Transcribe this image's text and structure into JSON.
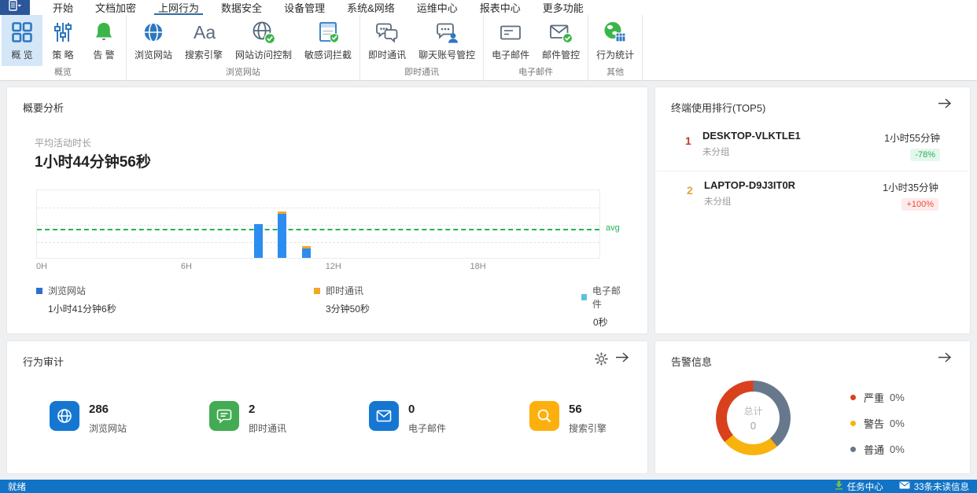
{
  "menubar": {
    "tabs": [
      {
        "name": "start",
        "label": "开始",
        "active": false
      },
      {
        "name": "doc-encrypt",
        "label": "文档加密",
        "active": false
      },
      {
        "name": "internet-behavior",
        "label": "上网行为",
        "active": true
      },
      {
        "name": "data-security",
        "label": "数据安全",
        "active": false
      },
      {
        "name": "device-mgmt",
        "label": "设备管理",
        "active": false
      },
      {
        "name": "system-network",
        "label": "系统&网络",
        "active": false
      },
      {
        "name": "ops-center",
        "label": "运维中心",
        "active": false
      },
      {
        "name": "report-center",
        "label": "报表中心",
        "active": false
      },
      {
        "name": "more-features",
        "label": "更多功能",
        "active": false
      }
    ]
  },
  "ribbon": {
    "groups": [
      {
        "label": "概览",
        "buttons": [
          {
            "name": "overview",
            "label": "概 览",
            "icon": "overview-grid-icon",
            "selected": true
          },
          {
            "name": "policy",
            "label": "策 略",
            "icon": "policy-sliders-icon",
            "selected": false
          },
          {
            "name": "alarm",
            "label": "告 警",
            "icon": "alarm-bell-icon",
            "selected": false
          }
        ]
      },
      {
        "label": "浏览网站",
        "buttons": [
          {
            "name": "browse-web",
            "label": "浏览网站",
            "icon": "browse-globe-icon",
            "selected": false
          },
          {
            "name": "search-engine",
            "label": "搜索引擎",
            "icon": "search-engine-icon",
            "selected": false
          },
          {
            "name": "site-access-control",
            "label": "网站访问控制",
            "icon": "site-access-icon",
            "selected": false
          },
          {
            "name": "sensitive-word-block",
            "label": "敏感词拦截",
            "icon": "sensitive-word-icon",
            "selected": false
          }
        ]
      },
      {
        "label": "即时通讯",
        "buttons": [
          {
            "name": "im",
            "label": "即时通讯",
            "icon": "im-chat-icon",
            "selected": false
          },
          {
            "name": "chat-account-control",
            "label": "聊天账号管控",
            "icon": "chat-account-icon",
            "selected": false
          }
        ]
      },
      {
        "label": "电子邮件",
        "buttons": [
          {
            "name": "email",
            "label": "电子邮件",
            "icon": "email-icon",
            "selected": false
          },
          {
            "name": "mail-control",
            "label": "邮件管控",
            "icon": "mail-control-icon",
            "selected": false
          }
        ]
      },
      {
        "label": "其他",
        "buttons": [
          {
            "name": "behavior-stats",
            "label": "行为统计",
            "icon": "behavior-stats-icon",
            "selected": false
          }
        ]
      }
    ]
  },
  "summary_panel": {
    "title": "概要分析",
    "metric_label": "平均活动时长",
    "metric_value": "1小时44分钟56秒"
  },
  "chart_data": [
    {
      "id": "activity_by_hour",
      "type": "bar",
      "stacked": true,
      "x_unit": "hour of day",
      "x_range": [
        0,
        23.4
      ],
      "x_ticks": [
        {
          "hour": 0,
          "label": "0H"
        },
        {
          "hour": 6,
          "label": "6H"
        },
        {
          "hour": 12,
          "label": "12H"
        },
        {
          "hour": 18,
          "label": "18H"
        }
      ],
      "ylim": [
        0,
        60
      ],
      "y_unit": "minutes (estimated – y axis unlabeled)",
      "grid": "dashed quarters",
      "avg_line": {
        "label": "avg",
        "value": 26.5,
        "color": "#21b358"
      },
      "series": [
        {
          "name": "浏览网站",
          "color": "#2d8cf0",
          "points": [
            {
              "x": 9,
              "y": 29
            },
            {
              "x": 10,
              "y": 38.5
            },
            {
              "x": 11,
              "y": 8.5
            }
          ]
        },
        {
          "name": "即时通讯",
          "color": "#f5a623",
          "points": [
            {
              "x": 9,
              "y": 0
            },
            {
              "x": 10,
              "y": 1.5
            },
            {
              "x": 11,
              "y": 2
            }
          ]
        },
        {
          "name": "电子邮件",
          "color": "#5cc3dd",
          "points": []
        }
      ],
      "legend": [
        {
          "name": "浏览网站",
          "value": "1小时41分钟6秒",
          "color": "#2d6fd2"
        },
        {
          "name": "即时通讯",
          "value": "3分钟50秒",
          "color": "#f5a623"
        },
        {
          "name": "电子邮件",
          "value": "0秒",
          "color": "#5cc3dd"
        }
      ]
    },
    {
      "id": "alerts_donut",
      "type": "pie",
      "donut": true,
      "center_label": "总计",
      "center_value": "0",
      "segments": [
        {
          "name": "普通",
          "color": "#68788c",
          "sweep_deg": 140
        },
        {
          "name": "警告",
          "color": "#f8b30e",
          "sweep_deg": 90
        },
        {
          "name": "严重",
          "color": "#d9411e",
          "sweep_deg": 130
        }
      ],
      "legend": [
        {
          "label": "严重",
          "pct": "0%",
          "color": "#d9411e"
        },
        {
          "label": "警告",
          "pct": "0%",
          "color": "#f8b30e"
        },
        {
          "label": "普通",
          "pct": "0%",
          "color": "#68788c"
        }
      ]
    }
  ],
  "ranking_panel": {
    "title": "终端使用排行(TOP5)",
    "items": [
      {
        "rank": "1",
        "rank_color": "#c0392b",
        "name": "DESKTOP-VLKTLE1",
        "group": "未分组",
        "duration": "1小时55分钟",
        "delta": "-78%",
        "delta_color": "#27ae60",
        "delta_bg": "#e4f7ec"
      },
      {
        "rank": "2",
        "rank_color": "#e6a23c",
        "name": "LAPTOP-D9J3IT0R",
        "group": "未分组",
        "duration": "1小时35分钟",
        "delta": "+100%",
        "delta_color": "#e84c3d",
        "delta_bg": "#fdebeb"
      }
    ]
  },
  "audit_panel": {
    "title": "行为审计",
    "stats": [
      {
        "name": "browse-web",
        "value": "286",
        "label": "浏览网站",
        "icon": "globe-icon",
        "color": "#1677d2"
      },
      {
        "name": "im",
        "value": "2",
        "label": "即时通讯",
        "icon": "chat-icon",
        "color": "#42ab53"
      },
      {
        "name": "email",
        "value": "0",
        "label": "电子邮件",
        "icon": "mail-icon",
        "color": "#1677d2"
      },
      {
        "name": "search-engine",
        "value": "56",
        "label": "搜索引擎",
        "icon": "search-icon",
        "color": "#fdb00d"
      }
    ]
  },
  "alerts_panel": {
    "title": "告警信息"
  },
  "statusbar": {
    "ready": "就绪",
    "task_center": "任务中心",
    "unread": "33条未读信息"
  }
}
